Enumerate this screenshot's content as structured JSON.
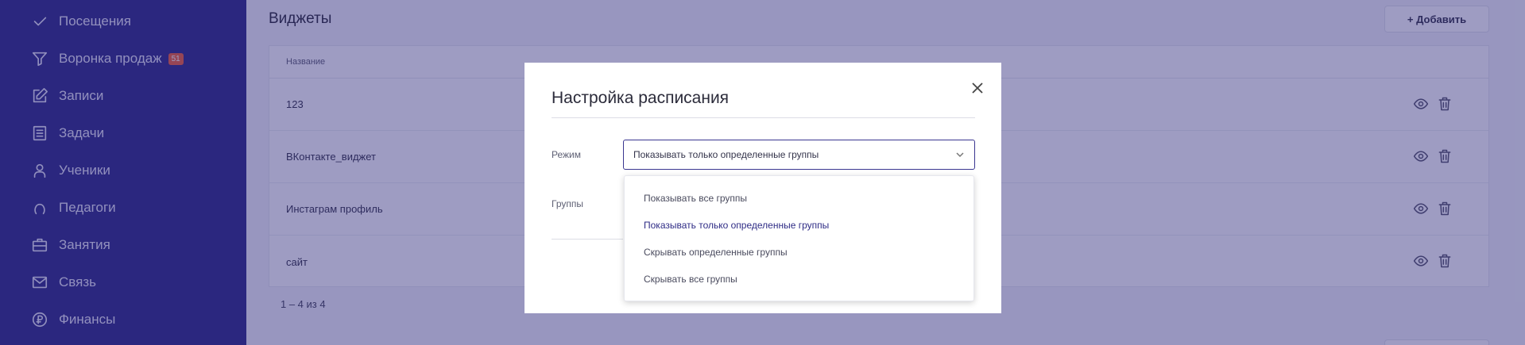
{
  "sidebar": {
    "items": [
      {
        "label": "Посещения",
        "icon": "check-icon"
      },
      {
        "label": "Воронка продаж",
        "icon": "funnel-icon",
        "badge": "51"
      },
      {
        "label": "Записи",
        "icon": "edit-icon"
      },
      {
        "label": "Задачи",
        "icon": "tasks-icon"
      },
      {
        "label": "Ученики",
        "icon": "user-icon"
      },
      {
        "label": "Педагоги",
        "icon": "teacher-icon"
      },
      {
        "label": "Занятия",
        "icon": "briefcase-icon"
      },
      {
        "label": "Связь",
        "icon": "mail-icon"
      },
      {
        "label": "Финансы",
        "icon": "money-icon"
      }
    ]
  },
  "main": {
    "title": "Виджеты",
    "add_label": "+ Добавить",
    "table": {
      "header": "Название",
      "rows": [
        "123",
        "ВКонтакте_виджет",
        "Инстаграм профиль",
        "сайт"
      ]
    },
    "pager": "1 – 4 из 4"
  },
  "modal": {
    "title": "Настройка расписания",
    "mode_label": "Режим",
    "mode_value": "Показывать только определенные группы",
    "groups_label": "Группы"
  },
  "dropdown": {
    "options": [
      "Показывать все группы",
      "Показывать только определенные группы",
      "Скрывать определенные группы",
      "Скрывать все группы"
    ],
    "selected": "Показывать только определенные группы"
  },
  "colors": {
    "sidebar": "#2e2b85",
    "overlay": "#282478",
    "badge": "#f0623a"
  }
}
